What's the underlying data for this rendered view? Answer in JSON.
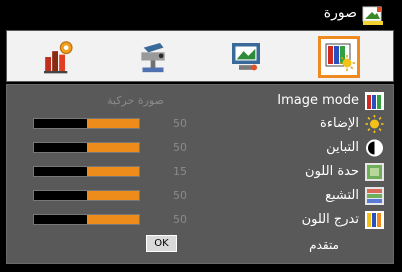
{
  "title": "صورة",
  "title_icon": "picture-monitor-icon",
  "tabs": [
    {
      "name": "tab-system-info",
      "icon": "bar-chart-gear-icon"
    },
    {
      "name": "tab-installation",
      "icon": "projector-setup-icon"
    },
    {
      "name": "tab-display",
      "icon": "display-screen-icon"
    },
    {
      "name": "tab-picture",
      "icon": "picture-sun-icon",
      "selected": true
    }
  ],
  "rows": {
    "image_mode": {
      "label": "Image mode",
      "value": "صورة حركية",
      "icon": "color-bars-icon"
    },
    "brightness": {
      "label": "الإضاءة",
      "value": "50",
      "level": 0.5,
      "icon": "sun-icon"
    },
    "contrast": {
      "label": "التباين",
      "value": "50",
      "level": 0.5,
      "icon": "half-circle-icon"
    },
    "sharpness": {
      "label": "حدة اللون",
      "value": "15",
      "level": 0.5,
      "icon": "sharpness-image-icon"
    },
    "saturation": {
      "label": "التشبع",
      "value": "50",
      "level": 0.5,
      "icon": "saturation-image-icon"
    },
    "hue": {
      "label": "تدرج اللون",
      "value": "50",
      "level": 0.5,
      "icon": "hue-bars-icon"
    },
    "advanced": {
      "label": "متقدم",
      "ok_label": "OK"
    }
  },
  "colors": {
    "accent": "#ED8C1A",
    "panel": "#595959",
    "tabbar": "#F2F2F2"
  }
}
